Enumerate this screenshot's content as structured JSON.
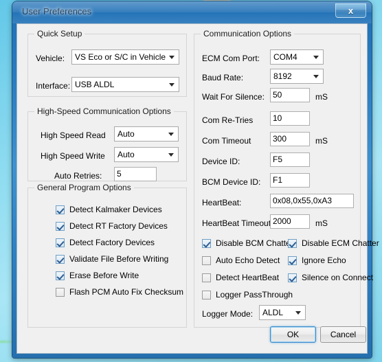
{
  "window": {
    "title": "User Preferences",
    "close_label": "x",
    "accent_color": "#2a7cc0"
  },
  "quick_setup": {
    "legend": "Quick Setup",
    "vehicle_label": "Vehicle:",
    "vehicle_value": "VS Eco or S/C in Vehicle",
    "interface_label": "Interface:",
    "interface_value": "USB ALDL"
  },
  "high_speed": {
    "legend": "High-Speed Communication Options",
    "read_label": "High Speed Read",
    "read_value": "Auto",
    "write_label": "High Speed Write",
    "write_value": "Auto",
    "retries_label": "Auto Retries:",
    "retries_value": "5"
  },
  "general_options": {
    "legend": "General Program Options",
    "items": [
      {
        "label": "Detect Kalmaker Devices",
        "checked": true
      },
      {
        "label": "Detect RT Factory Devices",
        "checked": true
      },
      {
        "label": "Detect Factory Devices",
        "checked": true
      },
      {
        "label": "Validate File Before Writing",
        "checked": true
      },
      {
        "label": "Erase Before Write",
        "checked": true
      },
      {
        "label": "Flash PCM Auto Fix Checksum",
        "checked": false
      }
    ]
  },
  "communication": {
    "legend": "Communication Options",
    "com_port_label": "ECM Com Port:",
    "com_port_value": "COM4",
    "baud_label": "Baud Rate:",
    "baud_value": "8192",
    "wait_silence_label": "Wait For Silence:",
    "wait_silence_value": "50",
    "wait_silence_unit": "mS",
    "retries_label": "Com Re-Tries",
    "retries_value": "10",
    "timeout_label": "Com Timeout",
    "timeout_value": "300",
    "timeout_unit": "mS",
    "device_id_label": "Device ID:",
    "device_id_value": "F5",
    "bcm_device_id_label": "BCM Device ID:",
    "bcm_device_id_value": "F1",
    "heartbeat_label": "HeartBeat:",
    "heartbeat_value": "0x08,0x55,0xA3",
    "heartbeat_timeout_label": "HeartBeat Timeout",
    "heartbeat_timeout_value": "2000",
    "heartbeat_timeout_unit": "mS",
    "checkboxes_left": [
      {
        "label": "Disable BCM Chatter",
        "checked": true
      },
      {
        "label": "Auto Echo Detect",
        "checked": false
      },
      {
        "label": "Detect HeartBeat",
        "checked": false
      },
      {
        "label": "Logger PassThrough",
        "checked": false
      }
    ],
    "checkboxes_right": [
      {
        "label": "Disable ECM Chatter",
        "checked": true
      },
      {
        "label": "Ignore Echo",
        "checked": true
      },
      {
        "label": "Silence on Connect",
        "checked": true
      }
    ],
    "logger_mode_label": "Logger Mode:",
    "logger_mode_value": "ALDL"
  },
  "footer": {
    "ok_label": "OK",
    "cancel_label": "Cancel"
  }
}
